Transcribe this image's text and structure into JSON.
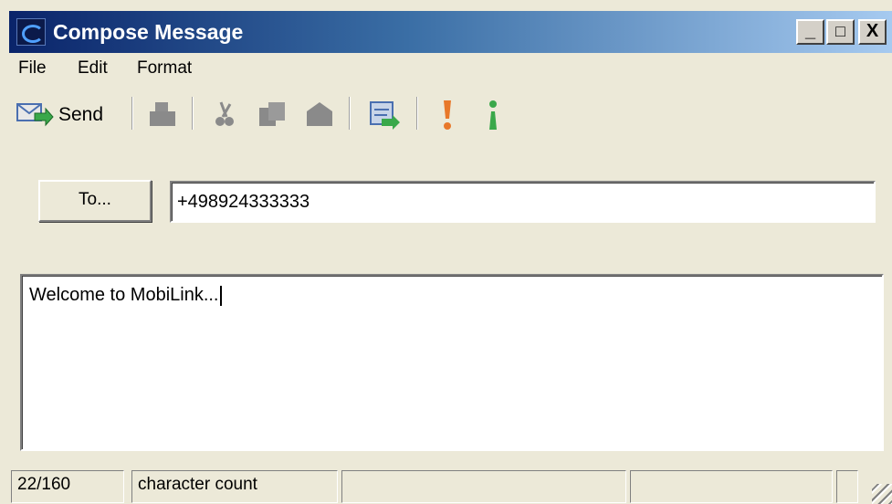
{
  "window": {
    "title": "Compose Message",
    "controls": {
      "minimize": "_",
      "maximize": "□",
      "close": "X"
    }
  },
  "menu": {
    "items": [
      "File",
      "Edit",
      "Format"
    ]
  },
  "toolbar": {
    "send_label": "Send",
    "icons": [
      "send-icon",
      "print-icon",
      "cut-icon",
      "copy-icon",
      "paste-icon",
      "address-book-icon",
      "high-priority-icon",
      "low-priority-icon"
    ],
    "colors": {
      "high_priority": "#e8782a",
      "low_priority": "#3aa84a"
    }
  },
  "compose": {
    "to_button_label": "To...",
    "to_value": "+498924333333",
    "message_text": "Welcome to MobiLink..."
  },
  "statusbar": {
    "count": "22/160",
    "count_label": "character count"
  }
}
